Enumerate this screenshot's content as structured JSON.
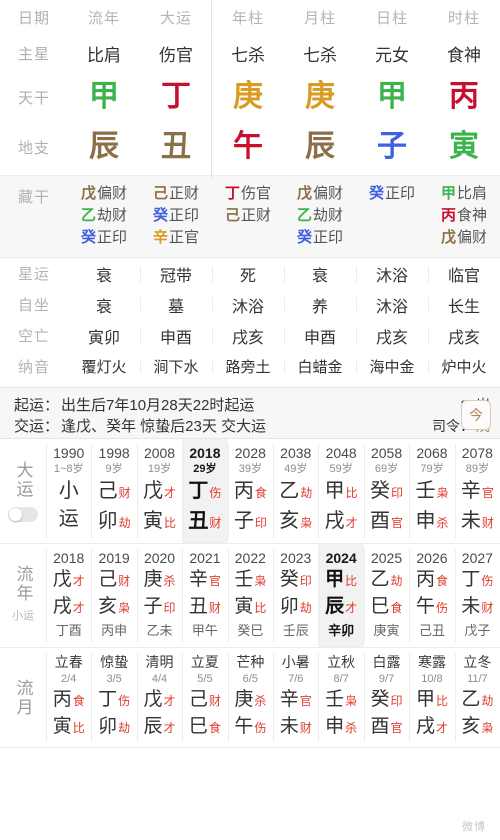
{
  "colors": {
    "wood": "#3cb44b",
    "fire": "#c8102e",
    "earth": "#8b6f47",
    "metal": "#d99b22",
    "water": "#4060e0",
    "accent_red": "#e23b2e",
    "label_gray": "#b4b4b4",
    "gold_border": "#d8cdb6"
  },
  "pillars": {
    "row_labels": {
      "date": "日期",
      "main_star": "主星",
      "heavenly_stem": "天干",
      "earthly_branch": "地支",
      "hidden_stems": "藏干",
      "star_luck": "星运",
      "self_sit": "自坐",
      "void": "空亡",
      "nayin": "纳音"
    },
    "columns": [
      {
        "header": "流年",
        "main_star": "比肩",
        "stem": "甲",
        "stem_el": "wood",
        "branch": "辰",
        "branch_el": "earth"
      },
      {
        "header": "大运",
        "main_star": "伤官",
        "stem": "丁",
        "stem_el": "fire",
        "branch": "丑",
        "branch_el": "earth"
      },
      {
        "header": "年柱",
        "main_star": "七杀",
        "stem": "庚",
        "stem_el": "metal",
        "branch": "午",
        "branch_el": "fire"
      },
      {
        "header": "月柱",
        "main_star": "七杀",
        "stem": "庚",
        "stem_el": "metal",
        "branch": "辰",
        "branch_el": "earth"
      },
      {
        "header": "日柱",
        "main_star": "元女",
        "stem": "甲",
        "stem_el": "wood",
        "branch": "子",
        "branch_el": "water"
      },
      {
        "header": "时柱",
        "main_star": "食神",
        "stem": "丙",
        "stem_el": "fire",
        "branch": "寅",
        "branch_el": "wood"
      }
    ],
    "hidden_stems": [
      [
        {
          "g": "戊",
          "el": "earth",
          "t": "偏财"
        },
        {
          "g": "乙",
          "el": "wood",
          "t": "劫财"
        },
        {
          "g": "癸",
          "el": "water",
          "t": "正印"
        }
      ],
      [
        {
          "g": "己",
          "el": "earth",
          "t": "正财"
        },
        {
          "g": "癸",
          "el": "water",
          "t": "正印"
        },
        {
          "g": "辛",
          "el": "metal",
          "t": "正官"
        }
      ],
      [
        {
          "g": "丁",
          "el": "fire",
          "t": "伤官"
        },
        {
          "g": "己",
          "el": "earth",
          "t": "正财"
        }
      ],
      [
        {
          "g": "戊",
          "el": "earth",
          "t": "偏财"
        },
        {
          "g": "乙",
          "el": "wood",
          "t": "劫财"
        },
        {
          "g": "癸",
          "el": "water",
          "t": "正印"
        }
      ],
      [
        {
          "g": "癸",
          "el": "water",
          "t": "正印"
        }
      ],
      [
        {
          "g": "甲",
          "el": "wood",
          "t": "比肩"
        },
        {
          "g": "丙",
          "el": "fire",
          "t": "食神"
        },
        {
          "g": "戊",
          "el": "earth",
          "t": "偏财"
        }
      ]
    ],
    "star_luck": [
      "衰",
      "冠带",
      "死",
      "衰",
      "沐浴",
      "临官"
    ],
    "self_sit": [
      "衰",
      "墓",
      "沐浴",
      "养",
      "沐浴",
      "长生"
    ],
    "void": [
      "寅卯",
      "申酉",
      "戌亥",
      "申酉",
      "戌亥",
      "戌亥"
    ],
    "nayin": [
      "覆灯火",
      "涧下水",
      "路旁土",
      "白蜡金",
      "海中金",
      "炉中火"
    ]
  },
  "luck_bar": {
    "start_label": "起运：",
    "start_value": "出生后7年10月28天22时起运",
    "switch_label": "交运：",
    "switch_value": "逢戊、癸年 惊蛰后23天 交大运",
    "age": "35岁",
    "siling_label": "司令：",
    "siling_value": "戊",
    "today_icon": "today-calendar-icon",
    "today_glyph": "今"
  },
  "dayun": {
    "label": "大运",
    "toggle_on": false,
    "columns": [
      {
        "year": "1990",
        "age": "1~8岁",
        "active": false,
        "stem": "小",
        "stem_god": "",
        "branch": "运",
        "branch_god": ""
      },
      {
        "year": "1998",
        "age": "9岁",
        "active": false,
        "stem": "己",
        "stem_god": "财",
        "branch": "卯",
        "branch_god": "劫"
      },
      {
        "year": "2008",
        "age": "19岁",
        "active": false,
        "stem": "戊",
        "stem_god": "才",
        "branch": "寅",
        "branch_god": "比"
      },
      {
        "year": "2018",
        "age": "29岁",
        "active": true,
        "stem": "丁",
        "stem_god": "伤",
        "branch": "丑",
        "branch_god": "财"
      },
      {
        "year": "2028",
        "age": "39岁",
        "active": false,
        "stem": "丙",
        "stem_god": "食",
        "branch": "子",
        "branch_god": "印"
      },
      {
        "year": "2038",
        "age": "49岁",
        "active": false,
        "stem": "乙",
        "stem_god": "劫",
        "branch": "亥",
        "branch_god": "枭"
      },
      {
        "year": "2048",
        "age": "59岁",
        "active": false,
        "stem": "甲",
        "stem_god": "比",
        "branch": "戌",
        "branch_god": "才"
      },
      {
        "year": "2058",
        "age": "69岁",
        "active": false,
        "stem": "癸",
        "stem_god": "印",
        "branch": "酉",
        "branch_god": "官"
      },
      {
        "year": "2068",
        "age": "79岁",
        "active": false,
        "stem": "壬",
        "stem_god": "枭",
        "branch": "申",
        "branch_god": "杀"
      },
      {
        "year": "2078",
        "age": "89岁",
        "active": false,
        "stem": "辛",
        "stem_god": "官",
        "branch": "未",
        "branch_god": "财"
      }
    ]
  },
  "liunian": {
    "label": "流年",
    "sub_label": "小运",
    "columns": [
      {
        "year": "2018",
        "active": false,
        "stem": "戊",
        "stem_god": "才",
        "branch": "戌",
        "branch_god": "才",
        "xiaoyun": "丁酉"
      },
      {
        "year": "2019",
        "active": false,
        "stem": "己",
        "stem_god": "财",
        "branch": "亥",
        "branch_god": "枭",
        "xiaoyun": "丙申"
      },
      {
        "year": "2020",
        "active": false,
        "stem": "庚",
        "stem_god": "杀",
        "branch": "子",
        "branch_god": "印",
        "xiaoyun": "乙未"
      },
      {
        "year": "2021",
        "active": false,
        "stem": "辛",
        "stem_god": "官",
        "branch": "丑",
        "branch_god": "财",
        "xiaoyun": "甲午"
      },
      {
        "year": "2022",
        "active": false,
        "stem": "壬",
        "stem_god": "枭",
        "branch": "寅",
        "branch_god": "比",
        "xiaoyun": "癸巳"
      },
      {
        "year": "2023",
        "active": false,
        "stem": "癸",
        "stem_god": "印",
        "branch": "卯",
        "branch_god": "劫",
        "xiaoyun": "壬辰"
      },
      {
        "year": "2024",
        "active": true,
        "stem": "甲",
        "stem_god": "比",
        "branch": "辰",
        "branch_god": "才",
        "xiaoyun": "辛卯"
      },
      {
        "year": "2025",
        "active": false,
        "stem": "乙",
        "stem_god": "劫",
        "branch": "巳",
        "branch_god": "食",
        "xiaoyun": "庚寅"
      },
      {
        "year": "2026",
        "active": false,
        "stem": "丙",
        "stem_god": "食",
        "branch": "午",
        "branch_god": "伤",
        "xiaoyun": "己丑"
      },
      {
        "year": "2027",
        "active": false,
        "stem": "丁",
        "stem_god": "伤",
        "branch": "未",
        "branch_god": "财",
        "xiaoyun": "戊子"
      }
    ]
  },
  "liuyue": {
    "label": "流月",
    "columns": [
      {
        "term": "立春",
        "date": "2/4",
        "stem": "丙",
        "stem_god": "食",
        "branch": "寅",
        "branch_god": "比"
      },
      {
        "term": "惊蛰",
        "date": "3/5",
        "stem": "丁",
        "stem_god": "伤",
        "branch": "卯",
        "branch_god": "劫"
      },
      {
        "term": "清明",
        "date": "4/4",
        "stem": "戊",
        "stem_god": "才",
        "branch": "辰",
        "branch_god": "才"
      },
      {
        "term": "立夏",
        "date": "5/5",
        "stem": "己",
        "stem_god": "财",
        "branch": "巳",
        "branch_god": "食"
      },
      {
        "term": "芒种",
        "date": "6/5",
        "stem": "庚",
        "stem_god": "杀",
        "branch": "午",
        "branch_god": "伤"
      },
      {
        "term": "小暑",
        "date": "7/6",
        "stem": "辛",
        "stem_god": "官",
        "branch": "未",
        "branch_god": "财"
      },
      {
        "term": "立秋",
        "date": "8/7",
        "stem": "壬",
        "stem_god": "枭",
        "branch": "申",
        "branch_god": "杀"
      },
      {
        "term": "白露",
        "date": "9/7",
        "stem": "癸",
        "stem_god": "印",
        "branch": "酉",
        "branch_god": "官"
      },
      {
        "term": "寒露",
        "date": "10/8",
        "stem": "甲",
        "stem_god": "比",
        "branch": "戌",
        "branch_god": "才"
      },
      {
        "term": "立冬",
        "date": "11/7",
        "stem": "乙",
        "stem_god": "劫",
        "branch": "亥",
        "branch_god": "枭"
      }
    ]
  },
  "watermark": "微博"
}
